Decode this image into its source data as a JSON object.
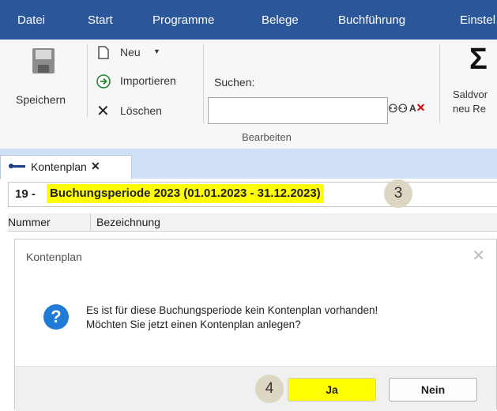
{
  "menu": {
    "items": [
      "Datei",
      "Start",
      "Programme",
      "Belege",
      "Buchführung",
      "Einstel"
    ]
  },
  "ribbon": {
    "save_label": "Speichern",
    "new_label": "Neu",
    "import_label": "Importieren",
    "delete_label": "Löschen",
    "search_label": "Suchen:",
    "search_value": "",
    "group_label": "Bearbeiten",
    "saldo_line1": "Saldvor",
    "saldo_line2": "neu Re",
    "sigma": "Σ"
  },
  "tab": {
    "label": "Kontenplan",
    "close": "✕"
  },
  "period": {
    "number": "19 -",
    "label": "Buchungsperiode 2023 (01.01.2023 - 31.12.2023)"
  },
  "grid": {
    "columns": [
      "Nummer",
      "Bezeichnung"
    ]
  },
  "callouts": {
    "step3": "3",
    "step4": "4"
  },
  "dialog": {
    "title": "Kontenplan",
    "close": "✕",
    "icon": "?",
    "message_line1": "Es ist für diese Buchungsperiode kein Kontenplan vorhanden!",
    "message_line2": "Möchten Sie jetzt einen Kontenplan anlegen?",
    "yes_label": "Ja",
    "no_label": "Nein"
  },
  "colors": {
    "menubar": "#2b579a",
    "highlight": "#ffff00",
    "tabstrip": "#cfe0f7",
    "question_icon": "#1f7bd6"
  }
}
